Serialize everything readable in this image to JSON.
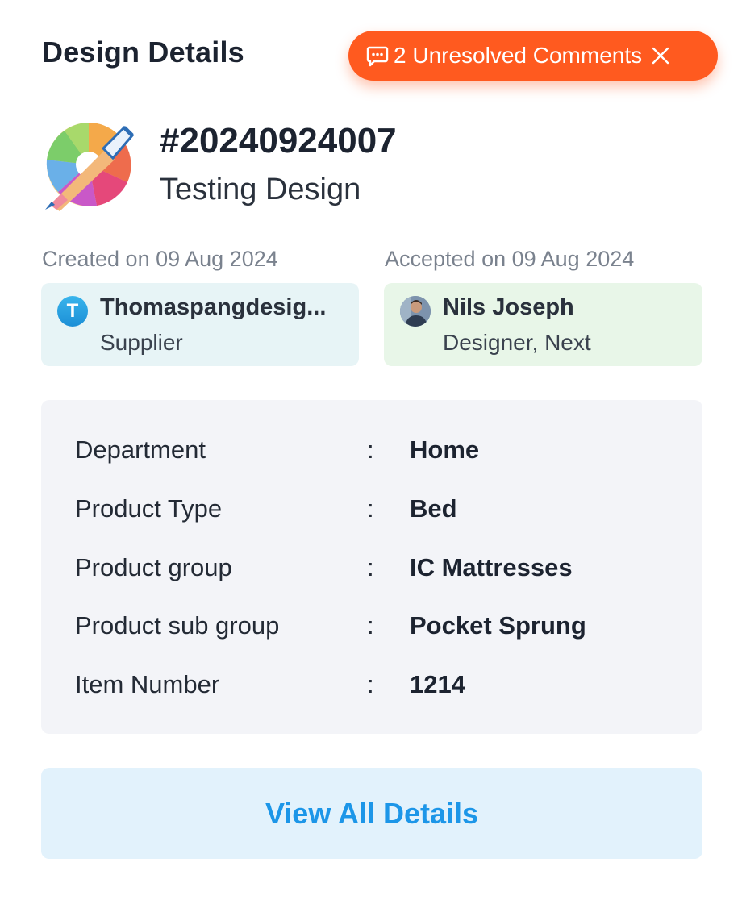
{
  "header": {
    "title": "Design Details",
    "comments_label": "2 Unresolved Comments",
    "comment_icon": "comment-icon",
    "close_icon": "close-icon"
  },
  "design": {
    "icon": "design-brush-palette-icon",
    "number": "#20240924007",
    "name": "Testing Design"
  },
  "created": {
    "label": "Created on 09 Aug 2024",
    "avatar_letter": "T",
    "name": "Thomaspangdesig...",
    "role": "Supplier"
  },
  "accepted": {
    "label": "Accepted on 09 Aug 2024",
    "name": "Nils Joseph",
    "role": "Designer, Next"
  },
  "details": [
    {
      "label": "Department",
      "value": "Home"
    },
    {
      "label": "Product Type",
      "value": "Bed"
    },
    {
      "label": "Product group",
      "value": "IC Mattresses"
    },
    {
      "label": "Product sub group",
      "value": "Pocket Sprung"
    },
    {
      "label": "Item Number",
      "value": "1214"
    }
  ],
  "separator": ":",
  "view_all_label": "View All Details",
  "colors": {
    "accent_orange": "#ff5a1f",
    "link_blue": "#1c96e8",
    "supplier_bg": "#e7f4f6",
    "designer_bg": "#e8f6e8",
    "panel_bg": "#f3f4f8"
  }
}
